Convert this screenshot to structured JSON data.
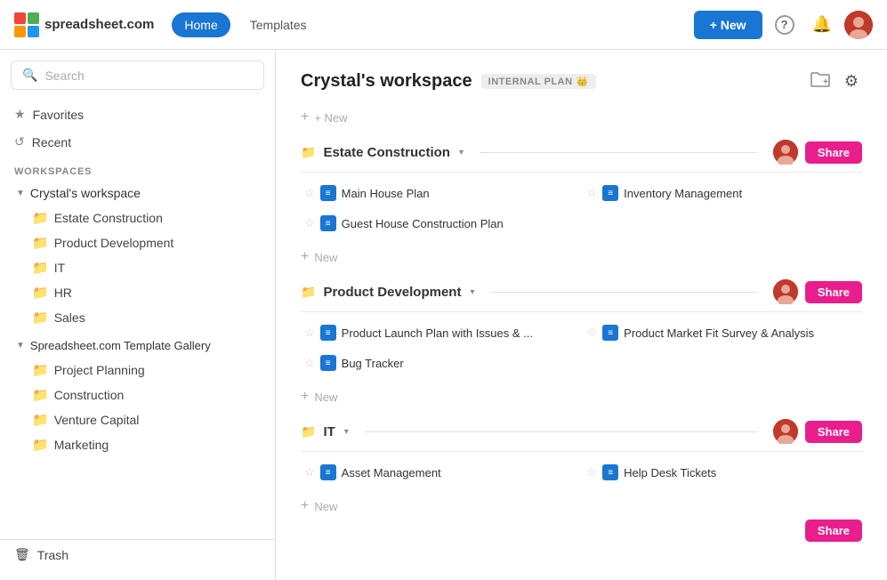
{
  "header": {
    "logo_text": "spreadsheet.com",
    "nav": [
      {
        "label": "Home",
        "active": true
      },
      {
        "label": "Templates",
        "active": false
      }
    ],
    "new_button": "+ New",
    "help_icon": "?",
    "bell_icon": "🔔"
  },
  "sidebar": {
    "search_placeholder": "Search",
    "favorites_label": "Favorites",
    "recent_label": "Recent",
    "workspaces_section": "WORKSPACES",
    "crystals_workspace": "Crystal's workspace",
    "workspace_folders": [
      "Estate Construction",
      "Product Development",
      "IT",
      "HR",
      "Sales"
    ],
    "gallery_name": "Spreadsheet.com Template Gallery",
    "gallery_folders": [
      "Project Planning",
      "Construction",
      "Venture Capital",
      "Marketing"
    ],
    "trash_label": "Trash"
  },
  "main": {
    "workspace_title": "Crystal's workspace",
    "workspace_badge": "INTERNAL PLAN",
    "crown_icon": "👑",
    "add_folder_icon": "+",
    "settings_icon": "⚙",
    "new_label": "+ New",
    "sections": [
      {
        "name": "Estate Construction",
        "items": [
          {
            "name": "Main House Plan",
            "starred": false
          },
          {
            "name": "Inventory Management",
            "starred": false
          },
          {
            "name": "Guest House Construction Plan",
            "starred": false
          }
        ]
      },
      {
        "name": "Product Development",
        "items": [
          {
            "name": "Product Launch Plan with Issues & ...",
            "starred": false
          },
          {
            "name": "Product Market Fit Survey & Analysis",
            "starred": false
          },
          {
            "name": "Bug Tracker",
            "starred": false
          }
        ]
      },
      {
        "name": "IT",
        "items": [
          {
            "name": "Asset Management",
            "starred": false
          },
          {
            "name": "Help Desk Tickets",
            "starred": false
          }
        ]
      }
    ]
  }
}
